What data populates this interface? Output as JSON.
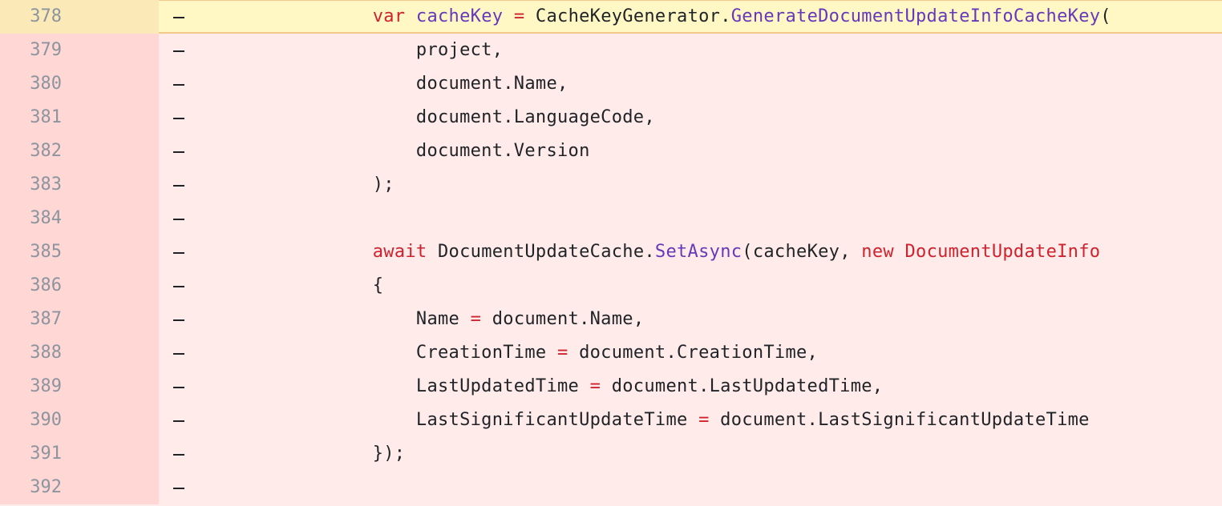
{
  "diff": {
    "marker_symbol": "-",
    "lines": [
      {
        "num": "378",
        "highlighted": true,
        "tokens": [
          {
            "t": "                ",
            "c": ""
          },
          {
            "t": "var",
            "c": "kw"
          },
          {
            "t": " ",
            "c": ""
          },
          {
            "t": "cacheKey",
            "c": "var"
          },
          {
            "t": " ",
            "c": ""
          },
          {
            "t": "=",
            "c": "op"
          },
          {
            "t": " CacheKeyGenerator.",
            "c": ""
          },
          {
            "t": "GenerateDocumentUpdateInfoCacheKey",
            "c": "fn"
          },
          {
            "t": "(",
            "c": ""
          }
        ]
      },
      {
        "num": "379",
        "highlighted": false,
        "tokens": [
          {
            "t": "                    project,",
            "c": ""
          }
        ]
      },
      {
        "num": "380",
        "highlighted": false,
        "tokens": [
          {
            "t": "                    document.Name,",
            "c": ""
          }
        ]
      },
      {
        "num": "381",
        "highlighted": false,
        "tokens": [
          {
            "t": "                    document.LanguageCode,",
            "c": ""
          }
        ]
      },
      {
        "num": "382",
        "highlighted": false,
        "tokens": [
          {
            "t": "                    document.Version",
            "c": ""
          }
        ]
      },
      {
        "num": "383",
        "highlighted": false,
        "tokens": [
          {
            "t": "                );",
            "c": ""
          }
        ]
      },
      {
        "num": "384",
        "highlighted": false,
        "tokens": []
      },
      {
        "num": "385",
        "highlighted": false,
        "tokens": [
          {
            "t": "                ",
            "c": ""
          },
          {
            "t": "await",
            "c": "kw"
          },
          {
            "t": " DocumentUpdateCache.",
            "c": ""
          },
          {
            "t": "SetAsync",
            "c": "fn"
          },
          {
            "t": "(cacheKey, ",
            "c": ""
          },
          {
            "t": "new",
            "c": "kw"
          },
          {
            "t": " ",
            "c": ""
          },
          {
            "t": "DocumentUpdateInfo",
            "c": "ty"
          }
        ]
      },
      {
        "num": "386",
        "highlighted": false,
        "tokens": [
          {
            "t": "                {",
            "c": ""
          }
        ]
      },
      {
        "num": "387",
        "highlighted": false,
        "tokens": [
          {
            "t": "                    Name ",
            "c": ""
          },
          {
            "t": "=",
            "c": "op"
          },
          {
            "t": " document.Name,",
            "c": ""
          }
        ]
      },
      {
        "num": "388",
        "highlighted": false,
        "tokens": [
          {
            "t": "                    CreationTime ",
            "c": ""
          },
          {
            "t": "=",
            "c": "op"
          },
          {
            "t": " document.CreationTime,",
            "c": ""
          }
        ]
      },
      {
        "num": "389",
        "highlighted": false,
        "tokens": [
          {
            "t": "                    LastUpdatedTime ",
            "c": ""
          },
          {
            "t": "=",
            "c": "op"
          },
          {
            "t": " document.LastUpdatedTime,",
            "c": ""
          }
        ]
      },
      {
        "num": "390",
        "highlighted": false,
        "tokens": [
          {
            "t": "                    LastSignificantUpdateTime ",
            "c": ""
          },
          {
            "t": "=",
            "c": "op"
          },
          {
            "t": " document.LastSignificantUpdateTime",
            "c": ""
          }
        ]
      },
      {
        "num": "391",
        "highlighted": false,
        "tokens": [
          {
            "t": "                });",
            "c": ""
          }
        ]
      },
      {
        "num": "392",
        "highlighted": false,
        "tokens": []
      }
    ]
  },
  "colors": {
    "deleted_line_bg": "#ffebe9",
    "deleted_gutter_bg": "#ffd7d5",
    "highlight_line_bg": "#fff8c5",
    "keyword": "#cf222e",
    "function": "#6639ba",
    "line_number": "#8c959f"
  }
}
